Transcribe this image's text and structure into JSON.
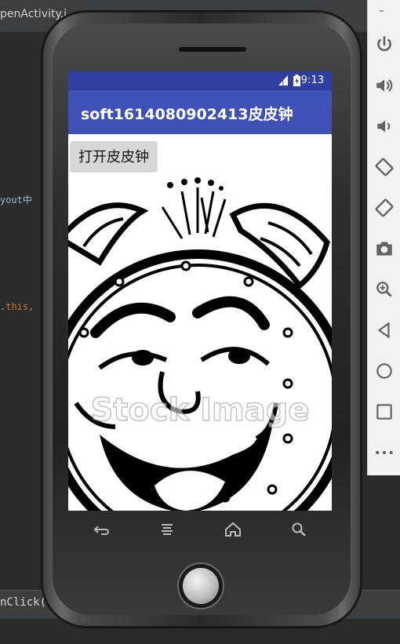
{
  "ide": {
    "tab_title": "penActivity.j",
    "code_line_1": "yout中",
    "code_line_2_prefix": ".",
    "code_line_2_kw": "this,",
    "bottom_text": "nClick()"
  },
  "toolbar": {
    "items": [
      "minimize-icon",
      "power-icon",
      "volume-up-icon",
      "volume-down-icon",
      "rotate-left-icon",
      "rotate-right-icon",
      "camera-icon",
      "zoom-icon",
      "back-icon",
      "home-icon",
      "overview-icon",
      "more-icon"
    ]
  },
  "status_bar": {
    "time": "9:13",
    "color": "#303f9f"
  },
  "app_bar": {
    "title": "soft1614080902413皮皮钟",
    "color": "#3f51b5"
  },
  "main": {
    "open_button_label": "打开皮皮钟",
    "image_alt": "laughing alarm clock cartoon",
    "watermark": "Stock Image"
  }
}
